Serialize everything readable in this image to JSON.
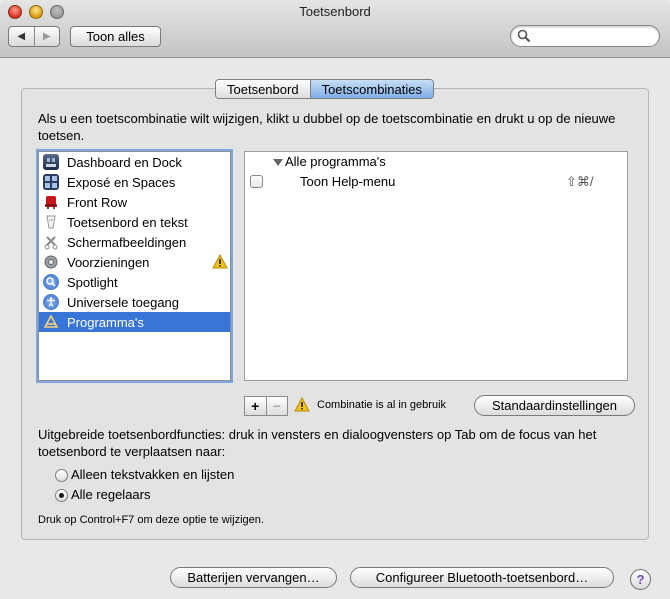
{
  "window": {
    "title": "Toetsenbord"
  },
  "toolbar": {
    "back_label": "◀",
    "forward_label": "▶",
    "show_all_label": "Toon alles",
    "search_value": "",
    "search_placeholder": ""
  },
  "tabs": [
    {
      "label": "Toetsenbord",
      "active": false
    },
    {
      "label": "Toetscombinaties",
      "active": true
    }
  ],
  "description": "Als u een toetscombinatie wilt wijzigen, klikt u dubbel op de toetscombinatie en drukt u op de nieuwe toetsen.",
  "categories": [
    {
      "label": "Dashboard en Dock",
      "icon": "dashboard-dock-icon"
    },
    {
      "label": "Exposé en Spaces",
      "icon": "expose-spaces-icon"
    },
    {
      "label": "Front Row",
      "icon": "front-row-icon"
    },
    {
      "label": "Toetsenbord en tekst",
      "icon": "keyboard-text-icon"
    },
    {
      "label": "Schermafbeeldingen",
      "icon": "screenshots-icon"
    },
    {
      "label": "Voorzieningen",
      "icon": "services-gear-icon",
      "warning": true
    },
    {
      "label": "Spotlight",
      "icon": "spotlight-icon"
    },
    {
      "label": "Universele toegang",
      "icon": "universal-access-icon"
    },
    {
      "label": "Programma's",
      "icon": "applications-icon",
      "selected": true
    }
  ],
  "shortcuts": {
    "group_label": "Alle programma's",
    "items": [
      {
        "label": "Toon Help-menu",
        "keys": "⇧⌘/",
        "checked": false
      }
    ]
  },
  "list_controls": {
    "add_label": "+",
    "remove_label": "−",
    "conflict_text": "Combinatie is al in gebruik",
    "defaults_label": "Standaardinstellingen"
  },
  "full_keyboard_access": {
    "text": "Uitgebreide toetsenbordfuncties: druk in vensters en dialoogvensters op Tab om de focus van het toetsenbord te verplaatsen naar:",
    "options": [
      {
        "label": "Alleen tekstvakken en lijsten",
        "selected": false
      },
      {
        "label": "Alle regelaars",
        "selected": true
      }
    ],
    "hint": "Druk op Control+F7 om deze optie te wijzigen."
  },
  "footer": {
    "battery_label": "Batterijen vervangen…",
    "bluetooth_label": "Configureer Bluetooth-toetsenbord…",
    "help_label": "?"
  },
  "colors": {
    "selection": "#3875d7",
    "warning": "#f2c31b",
    "help_accent": "#6b4bbd"
  }
}
